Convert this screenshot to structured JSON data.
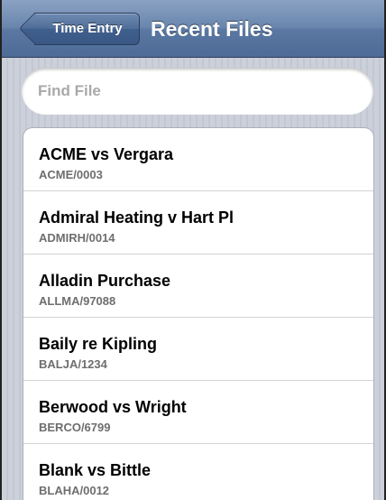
{
  "navbar": {
    "back_label": "Time Entry",
    "title": "Recent Files"
  },
  "search": {
    "placeholder": "Find File",
    "value": ""
  },
  "files": [
    {
      "name": "ACME vs Vergara",
      "code": "ACME/0003"
    },
    {
      "name": "Admiral Heating v Hart Pl",
      "code": "ADMIRH/0014"
    },
    {
      "name": "Alladin Purchase",
      "code": "ALLMA/97088"
    },
    {
      "name": "Baily re Kipling",
      "code": "BALJA/1234"
    },
    {
      "name": "Berwood vs Wright",
      "code": "BERCO/6799"
    },
    {
      "name": "Blank vs Bittle",
      "code": "BLAHA/0012"
    }
  ],
  "colors": {
    "navbar": "#5a78a2",
    "background": "#c7ccd6",
    "subtitle": "#6e6e6e"
  }
}
